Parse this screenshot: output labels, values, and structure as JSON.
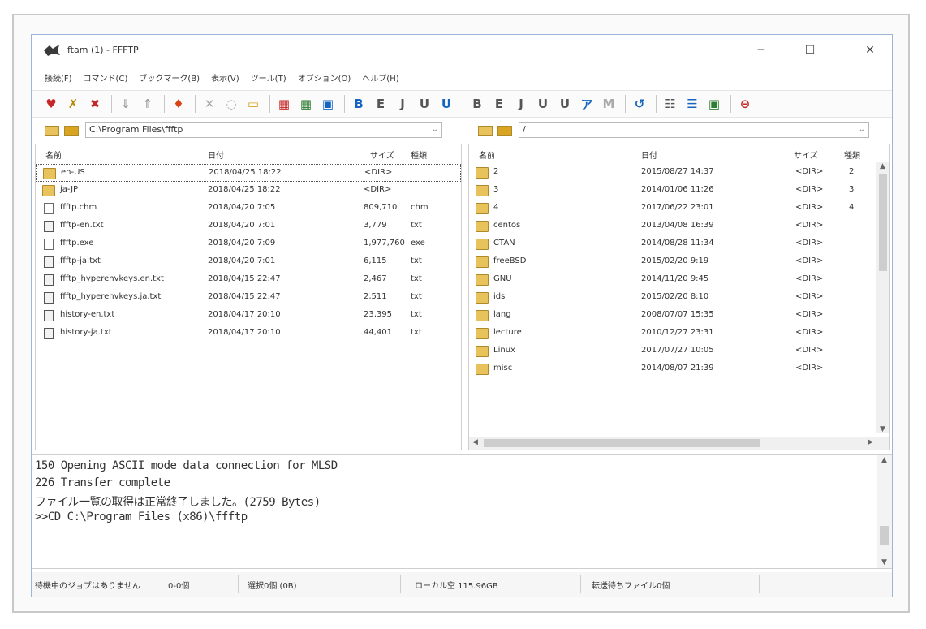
{
  "window": {
    "title": "ftam (1) - FFFTP",
    "minimize_glyph": "─",
    "maximize_glyph": "☐",
    "close_glyph": "✕"
  },
  "menu": [
    "接続(F)",
    "コマンド(C)",
    "ブックマーク(B)",
    "表示(V)",
    "ツール(T)",
    "オプション(O)",
    "ヘルプ(H)"
  ],
  "toolbar": {
    "groups": [
      [
        {
          "name": "connect-icon",
          "glyph": "♥",
          "color": "#c62828"
        },
        {
          "name": "quick-connect-icon",
          "glyph": "✗",
          "color": "#b8860b"
        },
        {
          "name": "disconnect-icon",
          "glyph": "✖",
          "color": "#c62828"
        }
      ],
      [
        {
          "name": "download-icon",
          "glyph": "⇓",
          "color": "#999999"
        },
        {
          "name": "upload-icon",
          "glyph": "⇑",
          "color": "#999999"
        }
      ],
      [
        {
          "name": "home-icon",
          "glyph": "♦",
          "color": "#d84315"
        }
      ],
      [
        {
          "name": "delete-icon",
          "glyph": "✕",
          "color": "#aaaaaa"
        },
        {
          "name": "rename-icon",
          "glyph": "◌",
          "color": "#aaaaaa"
        },
        {
          "name": "mkdir-icon",
          "glyph": "▭",
          "color": "#d9a520"
        }
      ],
      [
        {
          "name": "sync-icon",
          "glyph": "▦",
          "color": "#c62828"
        },
        {
          "name": "compare-icon",
          "glyph": "▦",
          "color": "#2e7d32"
        },
        {
          "name": "mirror-icon",
          "glyph": "▣",
          "color": "#1565c0"
        }
      ],
      [
        {
          "name": "bin-mode-icon",
          "glyph": "B",
          "color": "#1565c0"
        },
        {
          "name": "ascii-mode-icon",
          "glyph": "E",
          "color": "#555555"
        },
        {
          "name": "auto-mode-icon",
          "glyph": "J",
          "color": "#555555"
        },
        {
          "name": "kanji-utf8-icon",
          "glyph": "U",
          "color": "#555555"
        },
        {
          "name": "kanji-jis-icon",
          "glyph": "U",
          "color": "#1565c0"
        }
      ],
      [
        {
          "name": "host-bin-icon",
          "glyph": "B",
          "color": "#555555"
        },
        {
          "name": "host-euc-icon",
          "glyph": "E",
          "color": "#555555"
        },
        {
          "name": "host-jis-icon",
          "glyph": "J",
          "color": "#555555"
        },
        {
          "name": "host-utf-icon",
          "glyph": "U",
          "color": "#555555"
        },
        {
          "name": "host-utf8-icon",
          "glyph": "U",
          "color": "#555555"
        },
        {
          "name": "kana-icon",
          "glyph": "ア",
          "color": "#1565c0"
        },
        {
          "name": "nothing-icon",
          "glyph": "M",
          "color": "#aaaaaa"
        }
      ],
      [
        {
          "name": "refresh-icon",
          "glyph": "↺",
          "color": "#1565c0"
        }
      ],
      [
        {
          "name": "list-view-icon",
          "glyph": "☷",
          "color": "#555555"
        },
        {
          "name": "detail-view-icon",
          "glyph": "☰",
          "color": "#1565c0"
        },
        {
          "name": "queue-icon",
          "glyph": "▣",
          "color": "#2e7d32"
        }
      ],
      [
        {
          "name": "stop-icon",
          "glyph": "⊖",
          "color": "#c62828"
        }
      ]
    ]
  },
  "local": {
    "path": "C:\\Program Files\\ffftp",
    "columns": {
      "name": "名前",
      "date": "日付",
      "size": "サイズ",
      "type": "種類"
    },
    "rows": [
      {
        "icon": "folder",
        "name": "en-US",
        "date": "2018/04/25 18:22",
        "size": "<DIR>",
        "type": "",
        "selected": true
      },
      {
        "icon": "folder",
        "name": "ja-JP",
        "date": "2018/04/25 18:22",
        "size": "<DIR>",
        "type": ""
      },
      {
        "icon": "file",
        "name": "ffftp.chm",
        "date": "2018/04/20 7:05",
        "size": "809,710",
        "type": "chm"
      },
      {
        "icon": "text",
        "name": "ffftp-en.txt",
        "date": "2018/04/20 7:01",
        "size": "3,779",
        "type": "txt"
      },
      {
        "icon": "file",
        "name": "ffftp.exe",
        "date": "2018/04/20 7:09",
        "size": "1,977,760",
        "type": "exe"
      },
      {
        "icon": "text",
        "name": "ffftp-ja.txt",
        "date": "2018/04/20 7:01",
        "size": "6,115",
        "type": "txt"
      },
      {
        "icon": "text",
        "name": "ffftp_hyperenvkeys.en.txt",
        "date": "2018/04/15 22:47",
        "size": "2,467",
        "type": "txt"
      },
      {
        "icon": "text",
        "name": "ffftp_hyperenvkeys.ja.txt",
        "date": "2018/04/15 22:47",
        "size": "2,511",
        "type": "txt"
      },
      {
        "icon": "text",
        "name": "history-en.txt",
        "date": "2018/04/17 20:10",
        "size": "23,395",
        "type": "txt"
      },
      {
        "icon": "text",
        "name": "history-ja.txt",
        "date": "2018/04/17 20:10",
        "size": "44,401",
        "type": "txt"
      }
    ]
  },
  "remote": {
    "path": "/",
    "columns": {
      "name": "名前",
      "date": "日付",
      "size": "サイズ",
      "type": "種類"
    },
    "rows": [
      {
        "icon": "folder",
        "name": "2",
        "date": "2015/08/27 14:37",
        "size": "<DIR>",
        "type": "2"
      },
      {
        "icon": "folder",
        "name": "3",
        "date": "2014/01/06 11:26",
        "size": "<DIR>",
        "type": "3"
      },
      {
        "icon": "folder",
        "name": "4",
        "date": "2017/06/22 23:01",
        "size": "<DIR>",
        "type": "4"
      },
      {
        "icon": "folder",
        "name": "centos",
        "date": "2013/04/08 16:39",
        "size": "<DIR>",
        "type": ""
      },
      {
        "icon": "folder",
        "name": "CTAN",
        "date": "2014/08/28 11:34",
        "size": "<DIR>",
        "type": ""
      },
      {
        "icon": "folder",
        "name": "freeBSD",
        "date": "2015/02/20 9:19",
        "size": "<DIR>",
        "type": ""
      },
      {
        "icon": "folder",
        "name": "GNU",
        "date": "2014/11/20 9:45",
        "size": "<DIR>",
        "type": ""
      },
      {
        "icon": "folder",
        "name": "ids",
        "date": "2015/02/20 8:10",
        "size": "<DIR>",
        "type": ""
      },
      {
        "icon": "folder",
        "name": "lang",
        "date": "2008/07/07 15:35",
        "size": "<DIR>",
        "type": ""
      },
      {
        "icon": "folder",
        "name": "lecture",
        "date": "2010/12/27 23:31",
        "size": "<DIR>",
        "type": ""
      },
      {
        "icon": "folder",
        "name": "Linux",
        "date": "2017/07/27 10:05",
        "size": "<DIR>",
        "type": ""
      },
      {
        "icon": "folder",
        "name": "misc",
        "date": "2014/08/07 21:39",
        "size": "<DIR>",
        "type": ""
      }
    ]
  },
  "log": [
    "150 Opening ASCII mode data connection for MLSD",
    "226 Transfer complete",
    "ファイル一覧の取得は正常終了しました。(2759 Bytes)",
    ">>CD C:\\Program Files (x86)\\ffftp"
  ],
  "status": {
    "queue": "待機中のジョブはありません",
    "local_sel": "0-0個",
    "remote_sel": "選択0個 (0B)",
    "disk_free": "ローカル空 115.96GB",
    "transfer": "転送待ちファイル0個"
  }
}
